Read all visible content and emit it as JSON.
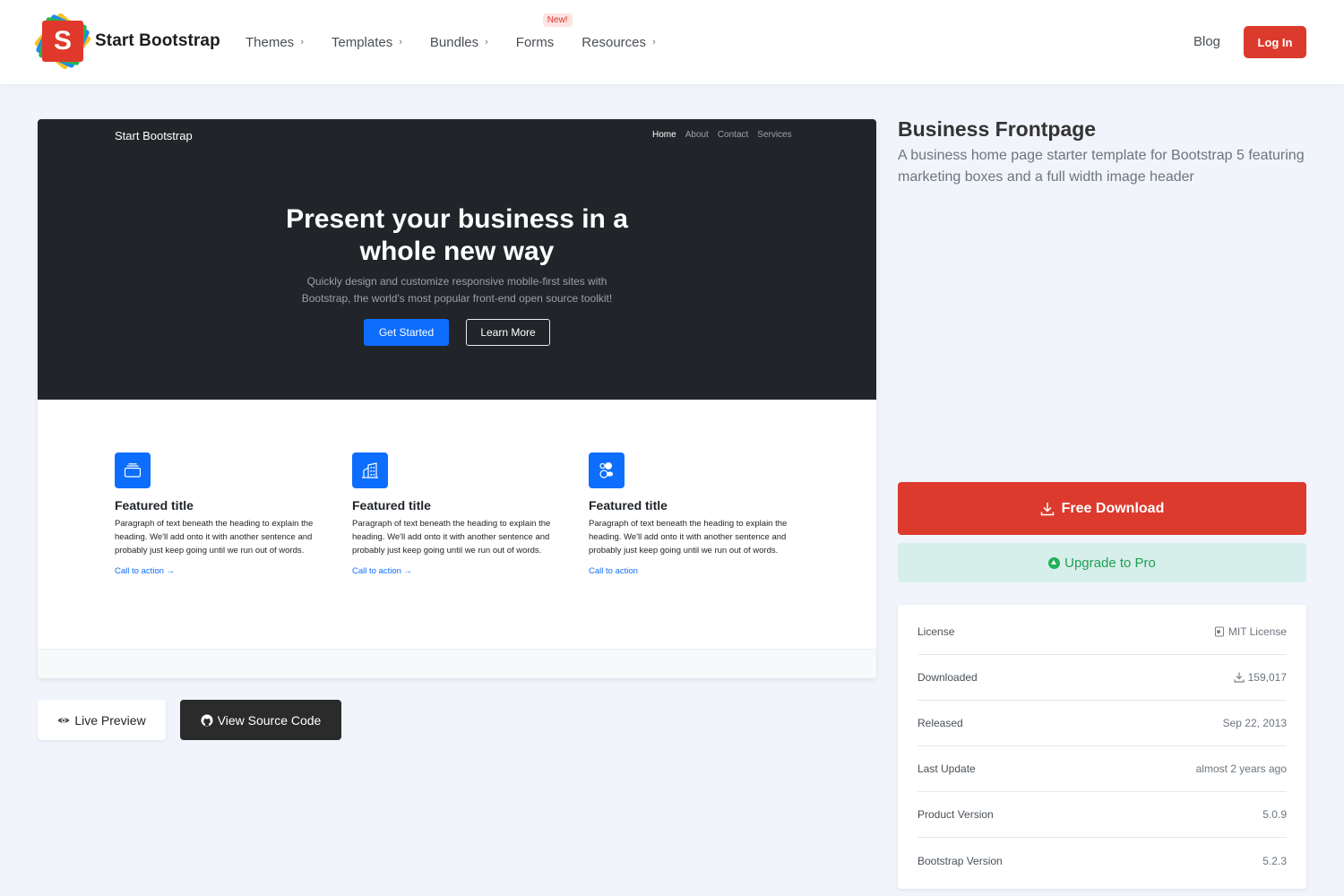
{
  "nav": {
    "brand": "Start Bootstrap",
    "logo_letter": "S",
    "links": [
      {
        "label": "Themes",
        "chevron": "›"
      },
      {
        "label": "Templates",
        "chevron": "›"
      },
      {
        "label": "Bundles",
        "chevron": "›"
      },
      {
        "label": "Forms",
        "badge": "New!"
      },
      {
        "label": "Resources",
        "chevron": "›"
      }
    ],
    "blog": "Blog",
    "login": "Log In"
  },
  "preview": {
    "brand": "Start Bootstrap",
    "nav": [
      "Home",
      "About",
      "Contact",
      "Services"
    ],
    "headline_line1": "Present your business in a",
    "headline_line2": "whole new way",
    "lead_line1": "Quickly design and customize responsive mobile-first sites with",
    "lead_line2": "Bootstrap, the world's most popular front-end open source toolkit!",
    "primary_button": "Get Started",
    "secondary_button": "Learn More",
    "features": [
      {
        "icon": "collection-icon",
        "title": "Featured title",
        "text": "Paragraph of text beneath the heading to explain the heading. We'll add onto it with another sentence and probably just keep going until we run out of words.",
        "cta": "Call to action →"
      },
      {
        "icon": "building-icon",
        "title": "Featured title",
        "text": "Paragraph of text beneath the heading to explain the heading. We'll add onto it with another sentence and probably just keep going until we run out of words.",
        "cta": "Call to action →"
      },
      {
        "icon": "toggles-icon",
        "title": "Featured title",
        "text": "Paragraph of text beneath the heading to explain the heading. We'll add onto it with another sentence and probably just keep going until we run out of words.",
        "cta": "Call to action"
      }
    ]
  },
  "actions": {
    "live_preview": "Live Preview",
    "view_source": "View Source Code"
  },
  "product": {
    "title": "Business Frontpage",
    "description": "A business home page starter template for Bootstrap 5 featuring marketing boxes and a full width image header",
    "download": "Free Download",
    "upgrade": "Upgrade to Pro"
  },
  "info": [
    {
      "label": "License",
      "value": "MIT License",
      "icon": "license-icon"
    },
    {
      "label": "Downloaded",
      "value": "159,017",
      "icon": "download-icon"
    },
    {
      "label": "Released",
      "value": "Sep 22, 2013"
    },
    {
      "label": "Last Update",
      "value": "almost 2 years ago"
    },
    {
      "label": "Product Version",
      "value": "5.0.9"
    },
    {
      "label": "Bootstrap Version",
      "value": "5.2.3"
    }
  ],
  "colors": {
    "brand_red": "#dc3a2d",
    "bootstrap_blue": "#0d6efd",
    "pro_green": "#1e9e56",
    "hero_dark": "#212529"
  }
}
